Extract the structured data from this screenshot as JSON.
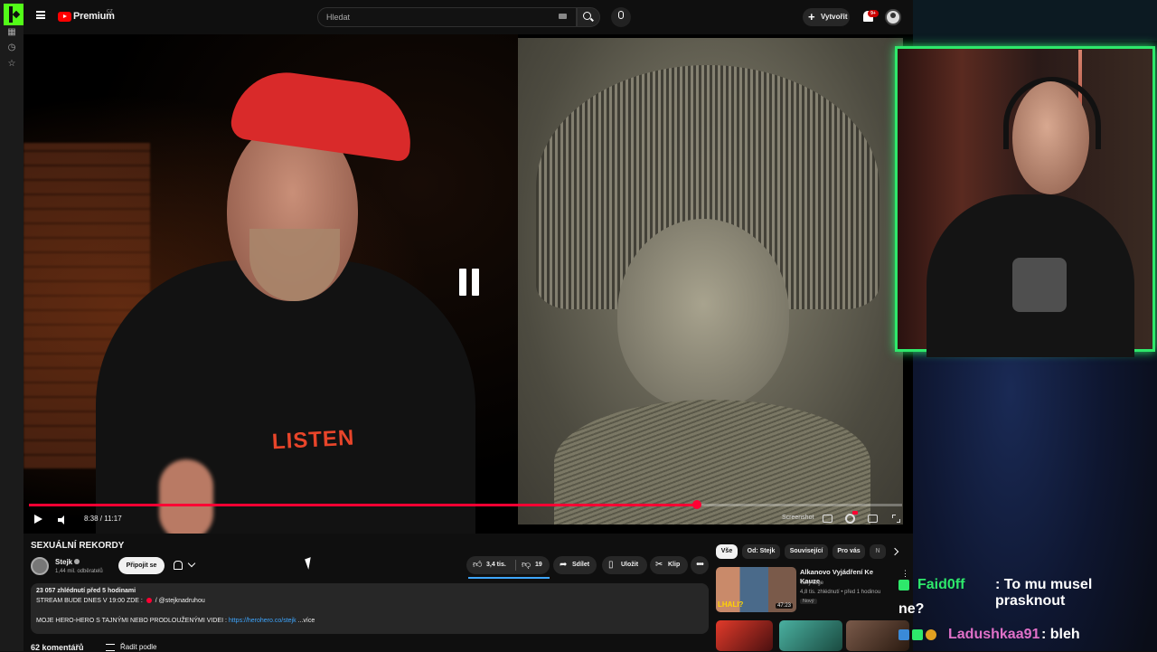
{
  "header": {
    "brand": "Premium",
    "brand_region": "CZ",
    "search_placeholder": "Hledat",
    "create_label": "Vytvořit",
    "notification_count": "9+"
  },
  "player": {
    "time": "8:38 / 11:17",
    "progress_fraction": 0.765,
    "screenshot_label": "Screenshot",
    "shirt_text": "LISTEN",
    "state": "paused"
  },
  "video": {
    "title": "SEXUÁLNÍ REKORDY",
    "channel": "Stejk",
    "subscribers": "1,44 mil. odběratelů",
    "join_label": "Připojit se",
    "likes": "3,4 tis.",
    "dislikes": "19",
    "share_label": "Sdílet",
    "save_label": "Uložit",
    "clip_label": "Klip",
    "more_label": "•••"
  },
  "description": {
    "stats": "23 057 zhlédnutí  před 5 hodinami",
    "line1_prefix": "STREAM BUDE DNES V 19:00 ZDE : ",
    "line1_handle": " / @stejknadruhou",
    "line2_prefix": "MOJE HERO-HERO S TAJNÝMI NEBO PRODLOUŽENÝMI VIDEI : ",
    "line2_link": "https://herohero.co/stejk",
    "line2_more": " ...více"
  },
  "comments": {
    "count_label": "62 komentářů",
    "sort_label": "Řadit podle"
  },
  "recommendations": {
    "chips": [
      "Vše",
      "Od: Stejk",
      "Související",
      "Pro vás",
      "N"
    ],
    "items": [
      {
        "title": "Alkanovo Vyjádření Ke Kauze",
        "channel": "Taky Bige",
        "meta": "4,8 tis. zhlédnutí • před 1 hodinou",
        "badge": "Nový",
        "duration": "47:23",
        "thumb_text": "LHALI?"
      }
    ]
  },
  "chat": [
    {
      "user": "Faid0ff",
      "text": " : To mu musel prasknout",
      "continuation": "ne?"
    },
    {
      "user": "Ladushkaa91",
      "text": " : bleh"
    }
  ],
  "colors": {
    "accent_red": "#ff0033",
    "kick_green": "#53fc18",
    "cam_border": "#2ee86b",
    "link_blue": "#3ea6ff"
  }
}
